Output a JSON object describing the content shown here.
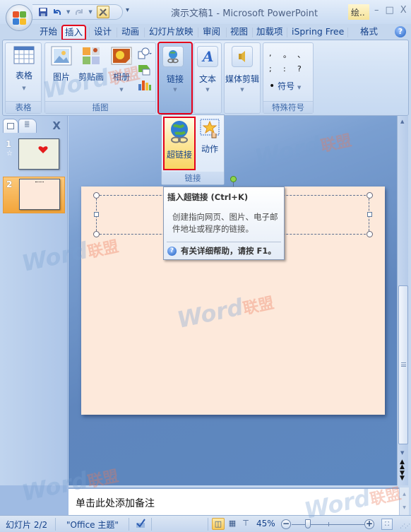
{
  "window": {
    "title": "演示文稿1 - Microsoft PowerPoint",
    "context_tab_label": "绘..",
    "controls": {
      "minimize": "–",
      "maximize": "□",
      "close": "X"
    }
  },
  "qat": {
    "save_icon": "save-icon",
    "undo_icon": "undo-icon",
    "redo_icon": "redo-icon",
    "customize": "▾"
  },
  "tabs": [
    {
      "label": "开始",
      "active": false
    },
    {
      "label": "插入",
      "active": true
    },
    {
      "label": "设计",
      "active": false
    },
    {
      "label": "动画",
      "active": false
    },
    {
      "label": "幻灯片放映",
      "active": false
    },
    {
      "label": "审阅",
      "active": false
    },
    {
      "label": "视图",
      "active": false
    },
    {
      "label": "加载项",
      "active": false
    },
    {
      "label": "iSpring Free",
      "active": false
    },
    {
      "label": "格式",
      "active": false
    }
  ],
  "help_label": "?",
  "ribbon": {
    "groups": {
      "table": {
        "label": "表格",
        "buttons": {
          "table": "表格"
        }
      },
      "illustrations": {
        "label": "插图",
        "buttons": {
          "picture": "图片",
          "clipart": "剪贴画",
          "album": "相册"
        }
      },
      "links": {
        "button": "链接"
      },
      "text": {
        "button": "文本"
      },
      "media": {
        "button": "媒体剪辑"
      },
      "symbols": {
        "label": "特殊符号",
        "symbols": [
          ",",
          "。",
          "、",
          ";",
          ":",
          "?"
        ],
        "symbol_button": "符号",
        "bullet": "•"
      }
    }
  },
  "links_submenu": {
    "hyperlink": "超链接",
    "action": "动作",
    "label": "链接"
  },
  "tooltip": {
    "title": "插入超链接 (Ctrl+K)",
    "body": "创建指向网页、图片、电子邮件地址或程序的链接。",
    "help": "有关详细帮助，请按 F1。"
  },
  "slides_panel": {
    "close": "X",
    "slides": [
      {
        "number": "1",
        "has_animation": true,
        "selected": false
      },
      {
        "number": "2",
        "has_animation": false,
        "selected": true
      }
    ]
  },
  "notes": {
    "placeholder": "单击此处添加备注"
  },
  "statusbar": {
    "slide_info": "幻灯片 2/2",
    "theme": "\"Office 主题\"",
    "zoom": "45%",
    "zoom_value_percent": 45
  },
  "watermark": {
    "text": "Word",
    "cn": "联盟"
  }
}
